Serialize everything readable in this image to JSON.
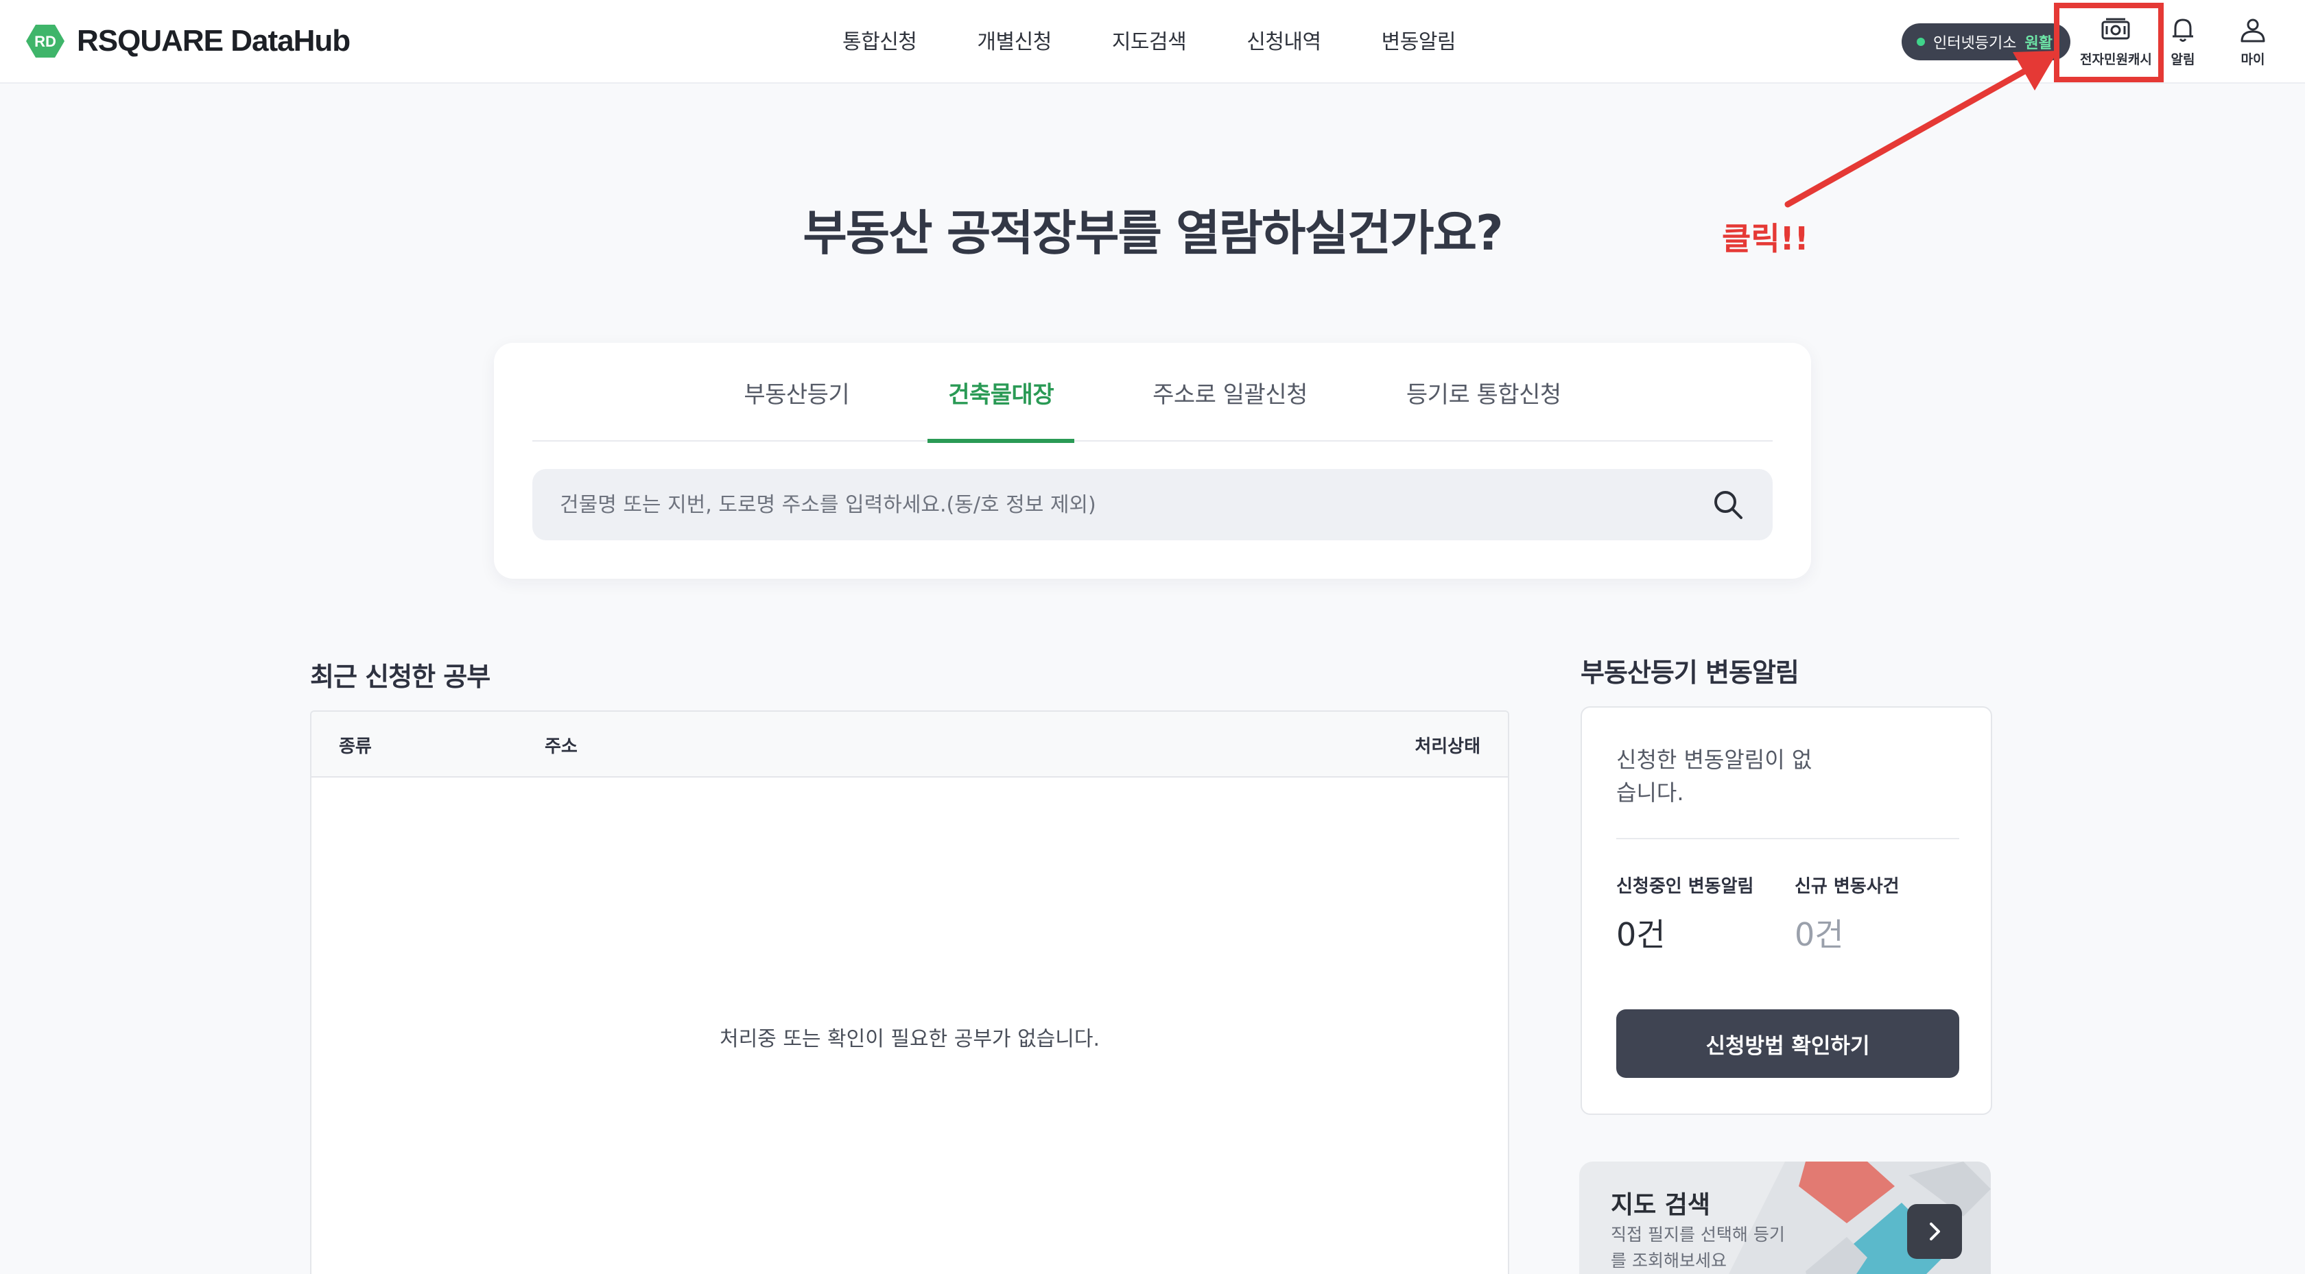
{
  "header": {
    "brand": "RSQUARE DataHub",
    "logo_mark": "RD",
    "nav": [
      "통합신청",
      "개별신청",
      "지도검색",
      "신청내역",
      "변동알림"
    ],
    "status": {
      "label": "인터넷등기소",
      "value": "원활"
    },
    "cash_label": "전자민원캐시",
    "alarm_label": "알림",
    "my_label": "마이"
  },
  "hero": {
    "title": "부동산 공적장부를 열람하실건가요?"
  },
  "search": {
    "tabs": [
      "부동산등기",
      "건축물대장",
      "주소로 일괄신청",
      "등기로 통합신청"
    ],
    "active_tab": "건축물대장",
    "placeholder": "건물명 또는 지번, 도로명 주소를 입력하세요.(동/호 정보 제외)"
  },
  "recent": {
    "title": "최근 신청한 공부",
    "columns": [
      "종류",
      "주소",
      "처리상태"
    ],
    "empty_message": "처리중 또는 확인이 필요한 공부가 없습니다."
  },
  "alerts": {
    "title": "부동산등기 변동알림",
    "empty_message": "신청한 변동알림이 없습니다.",
    "stats": [
      {
        "label": "신청중인 변동알림",
        "value": "0건"
      },
      {
        "label": "신규 변동사건",
        "value": "0건"
      }
    ],
    "button_label": "신청방법 확인하기"
  },
  "map_search": {
    "title": "지도 검색",
    "description": "직접 필지를 선택해 등기를 조회해보세요"
  },
  "annotation": {
    "text": "클릭!!"
  },
  "colors": {
    "accent": "#2a9a55",
    "annotation": "#e53935",
    "dark_button": "#3f4452"
  }
}
